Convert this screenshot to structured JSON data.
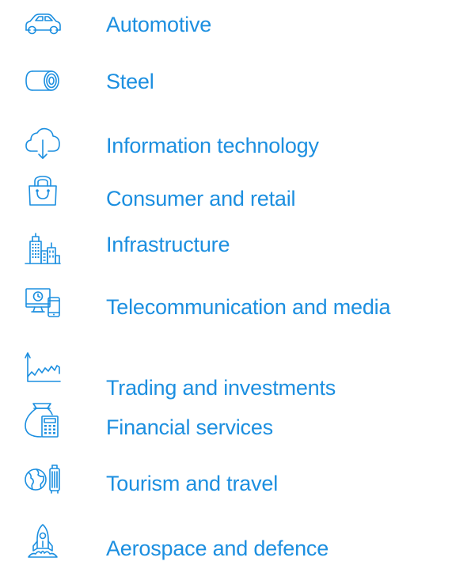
{
  "accent_color": "#1c8fe0",
  "industries": [
    {
      "label": "Automotive",
      "icon": "car-icon"
    },
    {
      "label": "Steel",
      "icon": "steel-coil-icon"
    },
    {
      "label": "Information technology",
      "icon": "cloud-download-icon"
    },
    {
      "label": "Consumer and retail",
      "icon": "shopping-bag-icon"
    },
    {
      "label": "Infrastructure",
      "icon": "city-buildings-icon"
    },
    {
      "label": "Telecommunication and media",
      "icon": "monitor-phone-icon"
    },
    {
      "label": "Trading and investments",
      "icon": "stock-chart-icon"
    },
    {
      "label": "Financial services",
      "icon": "money-bag-calculator-icon"
    },
    {
      "label": "Tourism and travel",
      "icon": "globe-luggage-icon"
    },
    {
      "label": "Aerospace and defence",
      "icon": "rocket-icon"
    }
  ]
}
